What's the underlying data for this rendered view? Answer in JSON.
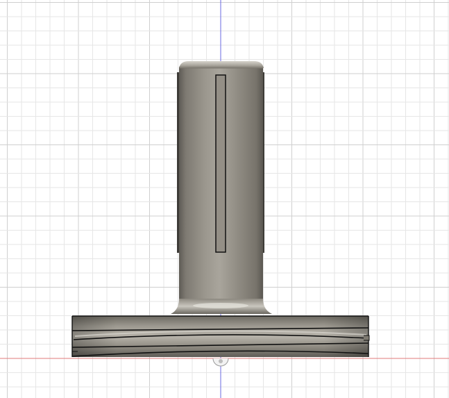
{
  "app": {
    "view": "front",
    "kind": "3d-cad-viewport"
  },
  "viewport": {
    "background_color": "#ffffff",
    "grid_minor_color": "#e6e6e6",
    "grid_major_color": "#cfcfcf",
    "vertical_axis_color": "#6a6ae0",
    "horizontal_axis_color": "#e07a7a"
  },
  "model": {
    "name": "",
    "body_color": "#8f8b83",
    "edge_color": "#111111",
    "highlight_color": "#d8d6cf",
    "shadow_color": "#5c5953"
  }
}
